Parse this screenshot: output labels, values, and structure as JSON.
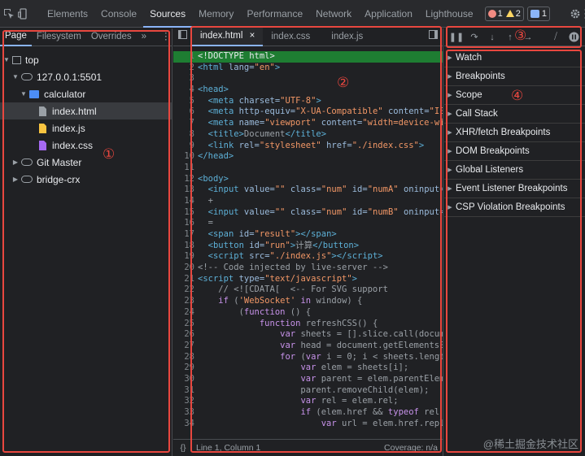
{
  "toolbar": {
    "tabs": [
      "Elements",
      "Console",
      "Sources",
      "Memory",
      "Performance",
      "Network",
      "Application",
      "Lighthouse"
    ],
    "error_count": "1",
    "warning_count": "2",
    "message_count": "1"
  },
  "navigator": {
    "tabs": [
      "Page",
      "Filesystem",
      "Overrides",
      "»"
    ],
    "tree": {
      "top": "top",
      "host": "127.0.0.1:5501",
      "folder": "calculator",
      "files": [
        "index.html",
        "index.js",
        "index.css"
      ],
      "other": [
        "Git Master",
        "bridge-crx"
      ]
    }
  },
  "editor": {
    "tabs": [
      "index.html",
      "index.css",
      "index.js"
    ],
    "status_position": "Line 1, Column 1",
    "status_coverage": "Coverage: n/a",
    "line_count": 34
  },
  "debugger": {
    "sections": [
      "Watch",
      "Breakpoints",
      "Scope",
      "Call Stack",
      "XHR/fetch Breakpoints",
      "DOM Breakpoints",
      "Global Listeners",
      "Event Listener Breakpoints",
      "CSP Violation Breakpoints"
    ]
  },
  "annotations": [
    "①",
    "②",
    "③",
    "④"
  ],
  "watermark": "@稀土掘金技术社区",
  "colors": {
    "accent": "#8ab4f8",
    "annotation": "#e8473f",
    "highlight_line": "#1e7d32"
  }
}
